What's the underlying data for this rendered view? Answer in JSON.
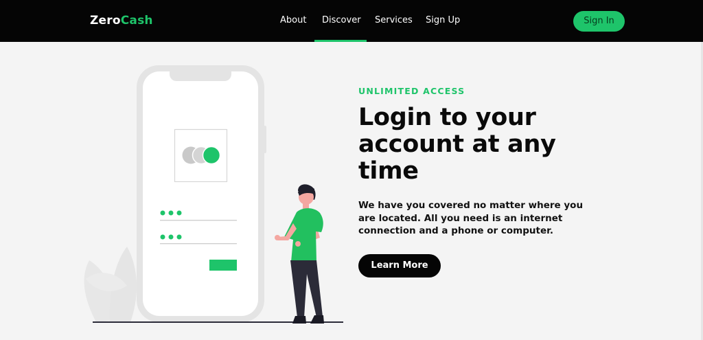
{
  "header": {
    "logo_main": "Zero",
    "logo_accent": "Cash",
    "nav": [
      {
        "label": "About",
        "active": false
      },
      {
        "label": "Discover",
        "active": true
      },
      {
        "label": "Services",
        "active": false
      },
      {
        "label": "Sign Up",
        "active": false
      }
    ],
    "signin_label": "Sign In"
  },
  "hero": {
    "eyebrow": "UNLIMITED ACCESS",
    "headline": "Login to your account at any time",
    "description": "We have you covered no matter where you are located. All you need is an internet connection and a phone or computer.",
    "cta_label": "Learn More"
  },
  "colors": {
    "accent": "#1ec46a",
    "header_bg": "#050505",
    "page_bg": "#f4f4f4",
    "text_dark": "#0a0a0a",
    "shirt": "#22c05f",
    "pants": "#2b2b38",
    "skin": "#f4a7a1"
  },
  "icons": [
    "phone-illustration",
    "card-icon",
    "password-dots-icon",
    "person-illustration",
    "leaf-decoration"
  ]
}
